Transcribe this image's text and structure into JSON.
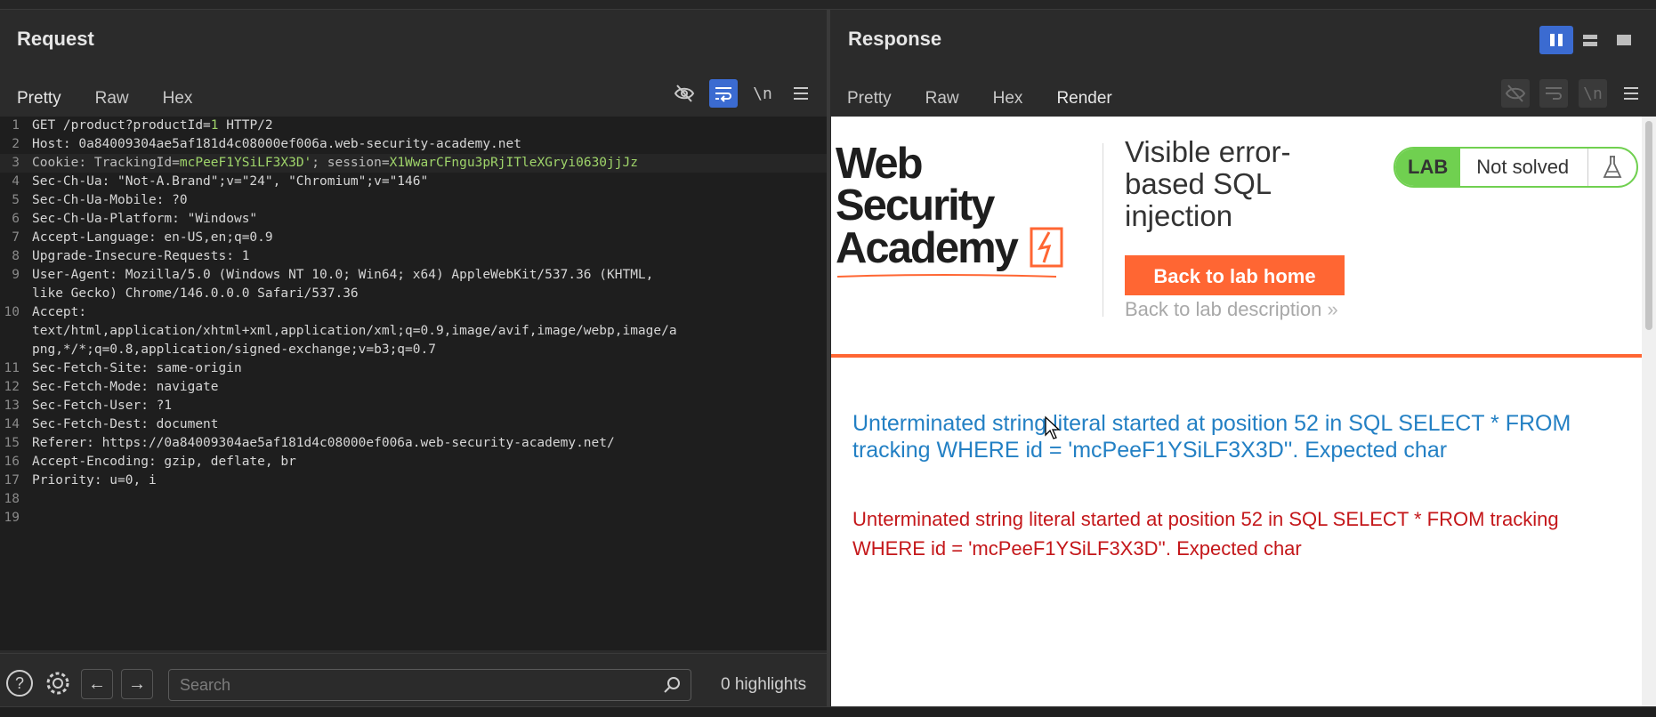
{
  "request": {
    "title": "Request",
    "tabs": [
      "Pretty",
      "Raw",
      "Hex"
    ],
    "active_tab": "Pretty",
    "lines": [
      {
        "n": "1",
        "segments": [
          [
            "GET /product?productId=",
            ""
          ],
          [
            "1",
            "cv"
          ],
          [
            " HTTP/2",
            ""
          ]
        ]
      },
      {
        "n": "2",
        "segments": [
          [
            "Host: 0a84009304ae5af181d4c08000ef006a.web-security-academy.net",
            ""
          ]
        ]
      },
      {
        "n": "3",
        "highlight": true,
        "segments": [
          [
            "Cookie: TrackingId=",
            "key"
          ],
          [
            "mcPeeF1YSiLF3X3D'",
            "cv"
          ],
          [
            "; session=",
            "key"
          ],
          [
            "X1WwarCFngu3pRjITleXGryi0630jjJz",
            "cv"
          ]
        ]
      },
      {
        "n": "4",
        "segments": [
          [
            "Sec-Ch-Ua: \"Not-A.Brand\";v=\"24\", \"Chromium\";v=\"146\"",
            ""
          ]
        ]
      },
      {
        "n": "5",
        "segments": [
          [
            "Sec-Ch-Ua-Mobile: ?0",
            ""
          ]
        ]
      },
      {
        "n": "6",
        "segments": [
          [
            "Sec-Ch-Ua-Platform: \"Windows\"",
            ""
          ]
        ]
      },
      {
        "n": "7",
        "segments": [
          [
            "Accept-Language: en-US,en;q=0.9",
            ""
          ]
        ]
      },
      {
        "n": "8",
        "segments": [
          [
            "Upgrade-Insecure-Requests: 1",
            ""
          ]
        ]
      },
      {
        "n": "9",
        "segments": [
          [
            "User-Agent: Mozilla/5.0 (Windows NT 10.0; Win64; x64) AppleWebKit/537.36 (KHTML,",
            ""
          ]
        ]
      },
      {
        "n": "",
        "segments": [
          [
            "like Gecko) Chrome/146.0.0.0 Safari/537.36",
            ""
          ]
        ]
      },
      {
        "n": "10",
        "segments": [
          [
            "Accept:",
            ""
          ]
        ]
      },
      {
        "n": "",
        "segments": [
          [
            "text/html,application/xhtml+xml,application/xml;q=0.9,image/avif,image/webp,image/a",
            ""
          ]
        ]
      },
      {
        "n": "",
        "segments": [
          [
            "png,*/*;q=0.8,application/signed-exchange;v=b3;q=0.7",
            ""
          ]
        ]
      },
      {
        "n": "11",
        "segments": [
          [
            "Sec-Fetch-Site: same-origin",
            ""
          ]
        ]
      },
      {
        "n": "12",
        "segments": [
          [
            "Sec-Fetch-Mode: navigate",
            ""
          ]
        ]
      },
      {
        "n": "13",
        "segments": [
          [
            "Sec-Fetch-User: ?1",
            ""
          ]
        ]
      },
      {
        "n": "14",
        "segments": [
          [
            "Sec-Fetch-Dest: document",
            ""
          ]
        ]
      },
      {
        "n": "15",
        "segments": [
          [
            "Referer: https://0a84009304ae5af181d4c08000ef006a.web-security-academy.net/",
            ""
          ]
        ]
      },
      {
        "n": "16",
        "segments": [
          [
            "Accept-Encoding: gzip, deflate, br",
            ""
          ]
        ]
      },
      {
        "n": "17",
        "segments": [
          [
            "Priority: u=0, i",
            ""
          ]
        ]
      },
      {
        "n": "18",
        "segments": [
          [
            "",
            ""
          ]
        ]
      },
      {
        "n": "19",
        "segments": [
          [
            "",
            ""
          ]
        ]
      }
    ],
    "search_placeholder": "Search",
    "highlights": "0 highlights"
  },
  "response": {
    "title": "Response",
    "tabs": [
      "Pretty",
      "Raw",
      "Hex",
      "Render"
    ],
    "active_tab": "Render",
    "render": {
      "logo_line1": "Web Security",
      "logo_line2": "Academy",
      "lab_title": "Visible error-based SQL injection",
      "lab_badge_label": "LAB",
      "lab_status": "Not solved",
      "back_button": "Back to lab home",
      "back_description": "Back to lab description",
      "error_heading": "Unterminated string literal started at position 52 in SQL SELECT * FROM tracking WHERE id = 'mcPeeF1YSiLF3X3D''. Expected char",
      "error_text": "Unterminated string literal started at position 52 in SQL SELECT * FROM tracking WHERE id = 'mcPeeF1YSiLF3X3D''. Expected char"
    }
  },
  "colors": {
    "accent_orange": "#ff6633",
    "tab_underline": "#e4642e",
    "button_blue": "#3b6bd1",
    "cookie_value_green": "#9fd46a",
    "error_blue": "#2380c4",
    "error_red": "#c4171a",
    "lab_green": "#70d050"
  }
}
